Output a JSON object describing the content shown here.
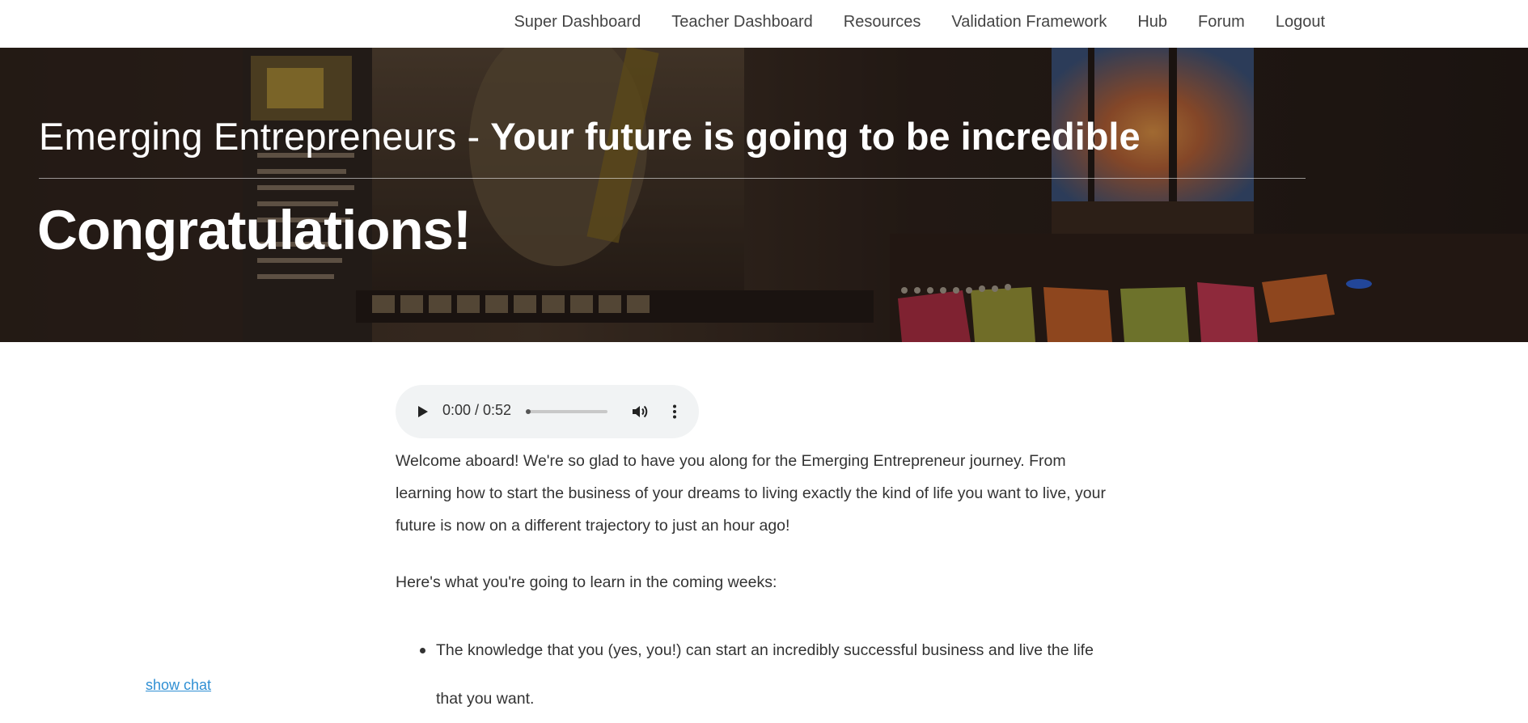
{
  "nav": {
    "items": [
      {
        "label": "Super Dashboard"
      },
      {
        "label": "Teacher Dashboard"
      },
      {
        "label": "Resources"
      },
      {
        "label": "Validation Framework"
      },
      {
        "label": "Hub"
      },
      {
        "label": "Forum"
      },
      {
        "label": "Logout"
      }
    ]
  },
  "hero": {
    "title_light": "Emerging Entrepreneurs",
    "title_separator": " - ",
    "title_bold": "Your future is going to be incredible",
    "heading": "Congratulations!"
  },
  "audio": {
    "time": "0:00 / 0:52",
    "progress_fraction": 0.0,
    "play_icon": "play-icon",
    "volume_icon": "volume-icon",
    "more_icon": "more-vertical-icon"
  },
  "content": {
    "intro": "Welcome aboard! We're so glad to have you along for the Emerging Entrepreneur journey. From learning how to start the business of your dreams to living exactly the kind of life you want to live, your future is now on a different trajectory to just an hour ago!",
    "learn_intro": "Here's what you're going to learn in the coming weeks:",
    "bullets": [
      "The knowledge that you (yes, you!) can start an incredibly successful business and live the life that you want."
    ]
  },
  "chat": {
    "toggle_label": "show chat"
  },
  "colors": {
    "link": "#2f8fd3",
    "audio_bg": "#f1f3f4",
    "hero_overlay": "#2c221c"
  }
}
